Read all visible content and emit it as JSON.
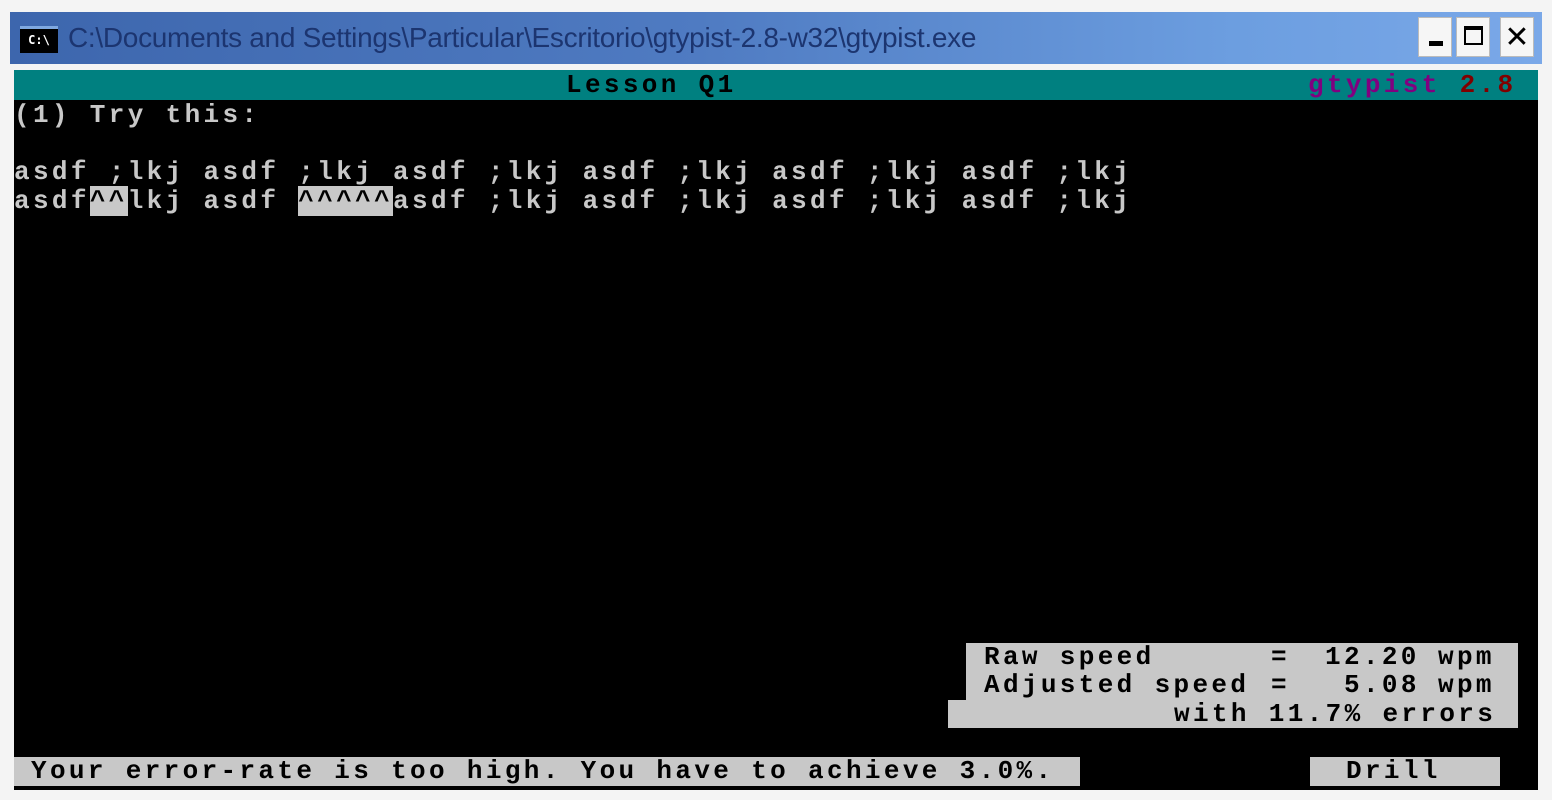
{
  "window": {
    "title": "C:\\Documents and Settings\\Particular\\Escritorio\\gtypist-2.8-w32\\gtypist.exe",
    "icon_label": "C:\\",
    "buttons": {
      "minimize": "minimize",
      "maximize": "maximize",
      "close": "✕"
    }
  },
  "terminal": {
    "header": {
      "lesson": "Lesson Q1",
      "app_name": "gtypist",
      "app_version": "2.8",
      "colors": {
        "header_bg": "#008080",
        "app_name": "#800080",
        "app_version": "#800000"
      }
    },
    "prompt": "(1) Try this:",
    "exercise_line": "asdf ;lkj asdf ;lkj asdf ;lkj asdf ;lkj asdf ;lkj asdf ;lkj",
    "typed_line": {
      "segments": [
        {
          "text": "asdf",
          "error": false
        },
        {
          "text": "^^",
          "error": true
        },
        {
          "text": "lkj asdf ",
          "error": false
        },
        {
          "text": "^^^^^",
          "error": true
        },
        {
          "text": "asdf ;lkj asdf ;lkj asdf ;lkj asdf ;lkj",
          "error": false
        }
      ]
    },
    "stats": {
      "raw_speed_label": "Raw speed",
      "raw_speed_value": "12.20",
      "adjusted_speed_label": "Adjusted speed",
      "adjusted_speed_value": "5.08",
      "unit": "wpm",
      "equals": "=",
      "error_line": "with 11.7% errors",
      "error_rate_percent": 11.7
    },
    "status": {
      "message": "Your error-rate is too high. You have to achieve 3.0%.",
      "mode": "Drill"
    }
  }
}
